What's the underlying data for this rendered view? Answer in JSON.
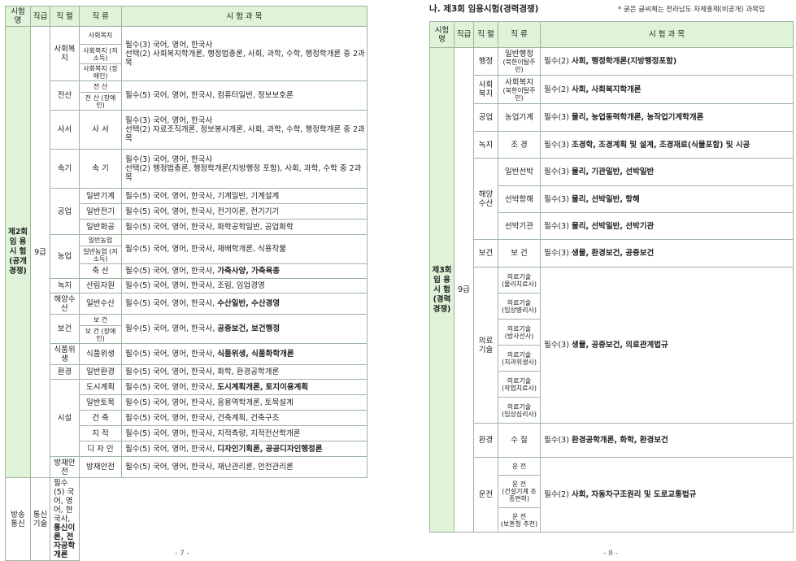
{
  "left": {
    "headers": [
      "시험명",
      "직급",
      "직 렬",
      "직 류",
      "시  험  과  목"
    ],
    "exam_name": "제2회 임 용 시 험 (공개 경쟁)",
    "grade": "9급",
    "page_number": "- 7 -",
    "groups": [
      {
        "series": "사회복지",
        "rows": [
          {
            "type": "사회복지",
            "subjects": "필수(3) 국어, 영어, 한국사"
          },
          {
            "type": "사회복지 (저소득)",
            "subjects": "선택(2) 사회복지학개론, 행정법총론, 사회, 과학, 수학, 행정학개론 중 2과목"
          },
          {
            "type": "사회복지 (장애인)",
            "subjects": ""
          }
        ]
      },
      {
        "series": "전산",
        "rows": [
          {
            "type": "전 산",
            "subjects": "필수(5) 국어, 영어, 한국사, 컴퓨터일반, 정보보호론"
          },
          {
            "type": "전 산 (장애인)",
            "subjects": ""
          }
        ]
      },
      {
        "series": "사서",
        "rows": [
          {
            "type": "사 서",
            "subjects": "필수(3) 국어, 영어, 한국사",
            "subjects2": "선택(2) 자료조직개론, 정보봉사개론, 사회, 과학, 수학, 행정학개론 중 2과목"
          }
        ]
      },
      {
        "series": "속기",
        "rows": [
          {
            "type": "속 기",
            "subjects": "필수(3) 국어, 영어, 한국사",
            "subjects2": "선택(2) 행정법총론, 행정학개론(지방행정 포함), 사회, 과학, 수학 중 2과목"
          }
        ]
      },
      {
        "series": "공업",
        "rows": [
          {
            "type": "일반기계",
            "subjects": "필수(5) 국어, 영어, 한국사, 기계일반, 기계설계"
          },
          {
            "type": "일반전기",
            "subjects": "필수(5) 국어, 영어, 한국사, 전기이론, 전기기기"
          },
          {
            "type": "일반화공",
            "subjects": "필수(5) 국어, 영어, 한국사, 화학공학일반, 공업화학"
          }
        ]
      },
      {
        "series": "농업",
        "rows": [
          {
            "type": "일반농업",
            "subjects": "필수(5) 국어, 영어, 한국사, 재배학개론, 식용작물"
          },
          {
            "type": "일반농업 (저소득)",
            "subjects": ""
          },
          {
            "type": "축 산",
            "subjects": "필수(5) 국어, 영어, 한국사, ",
            "bold": "가축사양, 가축육종"
          }
        ]
      },
      {
        "series": "녹지",
        "rows": [
          {
            "type": "산림자원",
            "subjects": "필수(5) 국어, 영어, 한국사, 조림, 임업경영"
          }
        ]
      },
      {
        "series": "해양수산",
        "rows": [
          {
            "type": "일반수산",
            "subjects": "필수(5) 국어, 영어, 한국사, ",
            "bold": "수산일반, 수산경영"
          }
        ]
      },
      {
        "series": "보건",
        "rows": [
          {
            "type": "보 건",
            "subjects": "필수(5) 국어, 영어, 한국사, ",
            "bold": "공중보건, 보건행정"
          },
          {
            "type": "보 건 (장애인)",
            "subjects": ""
          }
        ]
      },
      {
        "series": "식품위생",
        "rows": [
          {
            "type": "식품위생",
            "subjects": "필수(5) 국어, 영어, 한국사, ",
            "bold": "식품위생, 식품화학개론"
          }
        ]
      },
      {
        "series": "환경",
        "rows": [
          {
            "type": "일반환경",
            "subjects": "필수(5) 국어, 영어, 한국사, 화학, 환경공학개론"
          }
        ]
      },
      {
        "series": "시설",
        "rows": [
          {
            "type": "도시계획",
            "subjects": "필수(5) 국어, 영어, 한국사, ",
            "bold": "도시계획개론, 토지이용계획"
          },
          {
            "type": "일반토목",
            "subjects": "필수(5) 국어, 영어, 한국사, 응용역학개론, 토목설계"
          },
          {
            "type": "건 축",
            "subjects": "필수(5) 국어, 영어, 한국사, 건축계획, 건축구조"
          },
          {
            "type": "지 적",
            "subjects": "필수(5) 국어, 영어, 한국사, 지적측량, 지적전산학개론"
          },
          {
            "type": "디 자 인",
            "subjects": "필수(5) 국어, 영어, 한국사, ",
            "bold": "디자인기획론, 공공디자인행정론"
          }
        ]
      },
      {
        "series": "방재안전",
        "rows": [
          {
            "type": "방재안전",
            "subjects": "필수(5) 국어, 영어, 한국사, 재난관리론, 안전관리론"
          }
        ]
      },
      {
        "series": "방송통신",
        "rows": [
          {
            "type": "통신기술",
            "subjects": "필수(5) 국어, 영어, 한국사, ",
            "bold": "통신이론, 전자공학개론"
          }
        ]
      }
    ]
  },
  "right": {
    "title": "나. 제3회 임용시험(경력경쟁)",
    "note": "* 굵은 글씨체는 전라남도 자체출제(비공개) 과목임",
    "headers": [
      "시험명",
      "직급",
      "직 렬",
      "직 류",
      "시  험  과  목"
    ],
    "exam_name": "제3회 임 용 시 험 (경력 경쟁)",
    "grade": "9급",
    "page_number": "- 8 -",
    "rows": [
      {
        "series": "행정",
        "type": "일반행정",
        "type_note": "(북한이탈주민)",
        "subjects": "필수(2) ",
        "bold": "사회, 행정학개론(지방행정포함)"
      },
      {
        "series": "사회복지",
        "type": "사회복지",
        "type_note": "(북한이탈주민)",
        "subjects": "필수(2) ",
        "bold": "사회, 사회복지학개론"
      },
      {
        "series": "공업",
        "type": "농업기계",
        "subjects": "필수(3) ",
        "bold": "물리, 농업동력학개론, 농작업기계학개론"
      },
      {
        "series": "녹지",
        "type": "조 경",
        "subjects": "필수(3) ",
        "bold": "조경학, 조경계획 및 설계, 조경재료(식물포함) 및 시공"
      },
      {
        "series": "해양수산",
        "type": "일반선박",
        "subjects": "필수(3) ",
        "bold": "물리, 기관일반, 선박일반"
      },
      {
        "series": "",
        "type": "선박항해",
        "subjects": "필수(3) ",
        "bold": "물리, 선박일반, 항해"
      },
      {
        "series": "",
        "type": "선박기관",
        "subjects": "필수(3) ",
        "bold": "물리, 선박일반, 선박기관"
      },
      {
        "series": "보건",
        "type": "보 건",
        "subjects": "필수(3) ",
        "bold": "생물, 환경보건, 공중보건"
      },
      {
        "series": "의료기술",
        "types": [
          {
            "type": "의료기술",
            "note": "(물리치료사)"
          },
          {
            "type": "의료기술",
            "note": "(임상병리사)"
          },
          {
            "type": "의료기술",
            "note": "(방사선사)"
          },
          {
            "type": "의료기술",
            "note": "(치과위생사)"
          },
          {
            "type": "의료기술",
            "note": "(작업치료사)"
          },
          {
            "type": "의료기술",
            "note": "(임상심리사)"
          }
        ],
        "subjects": "필수(3) ",
        "bold": "생물, 공중보건, 의료관계법규"
      },
      {
        "series": "환경",
        "type": "수 질",
        "subjects": "필수(3) ",
        "bold": "환경공학개론, 화학, 환경보건"
      },
      {
        "series": "운전",
        "types": [
          {
            "type": "운 전",
            "note": ""
          },
          {
            "type": "운 전",
            "note": "(건설기계 조종면허)"
          },
          {
            "type": "운 전",
            "note": "(보훈청 추천)"
          }
        ],
        "subjects": "필수(2) ",
        "bold": "사회, 자동차구조원리 및 도로교통법규"
      }
    ]
  }
}
